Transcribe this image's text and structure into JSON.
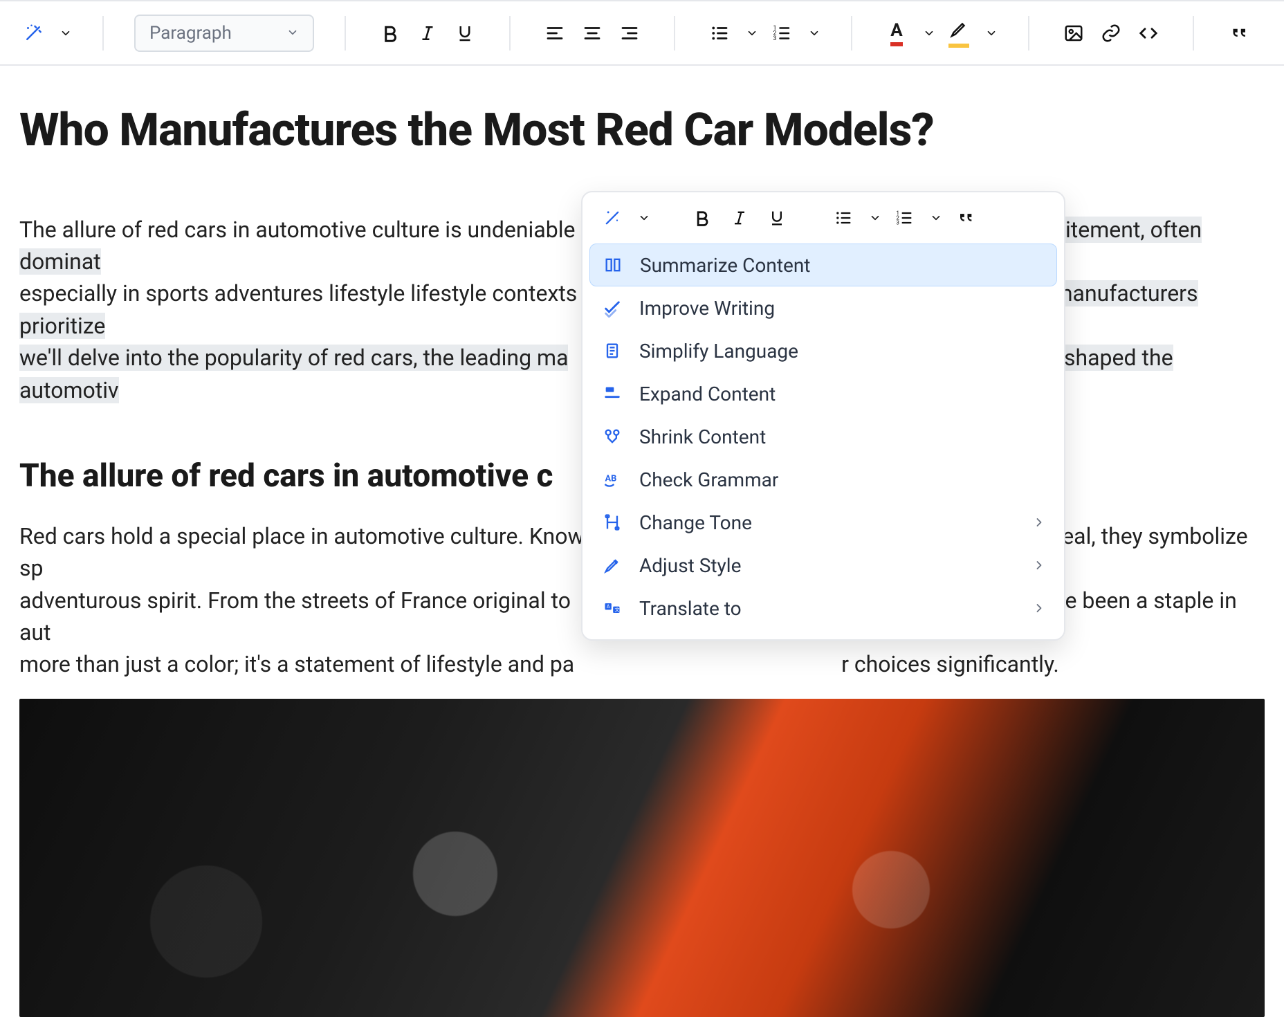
{
  "toolbar": {
    "style_label": "Paragraph"
  },
  "document": {
    "title": "Who Manufactures the Most Red Car Models?",
    "p1_a": "The allure of red cars in automotive culture is undeniable",
    "p1_b": "s with passion and excitement, often dominat",
    "p1_c": "especially in sports adventures lifestyle lifestyle contexts",
    "p1_d": "lscape reveals which manufacturers prioritize",
    "p1_e": "we'll delve into the popularity of red cars, the leading ma",
    "p1_f": "c red models that have shaped the automotiv",
    "h2": "The allure of red cars in automotive c",
    "p2_a": "Red cars hold a special place in automotive culture. Know",
    "p2_b": "ttention-grabbing appeal, they symbolize sp",
    "p2_c": "adventurous spirit. From the streets of France original to",
    "p2_d": "tisements, red cars have been a staple in aut",
    "p2_e": "more than just a color; it's a statement of lifestyle and pa",
    "p2_f": "r choices significantly."
  },
  "ai_menu": {
    "items": [
      {
        "label": "Summarize Content",
        "submenu": false,
        "active": true
      },
      {
        "label": "Improve Writing",
        "submenu": false,
        "active": false
      },
      {
        "label": "Simplify Language",
        "submenu": false,
        "active": false
      },
      {
        "label": "Expand Content",
        "submenu": false,
        "active": false
      },
      {
        "label": "Shrink Content",
        "submenu": false,
        "active": false
      },
      {
        "label": "Check Grammar",
        "submenu": false,
        "active": false
      },
      {
        "label": "Change Tone",
        "submenu": true,
        "active": false
      },
      {
        "label": "Adjust Style",
        "submenu": true,
        "active": false
      },
      {
        "label": "Translate to",
        "submenu": true,
        "active": false
      }
    ]
  }
}
